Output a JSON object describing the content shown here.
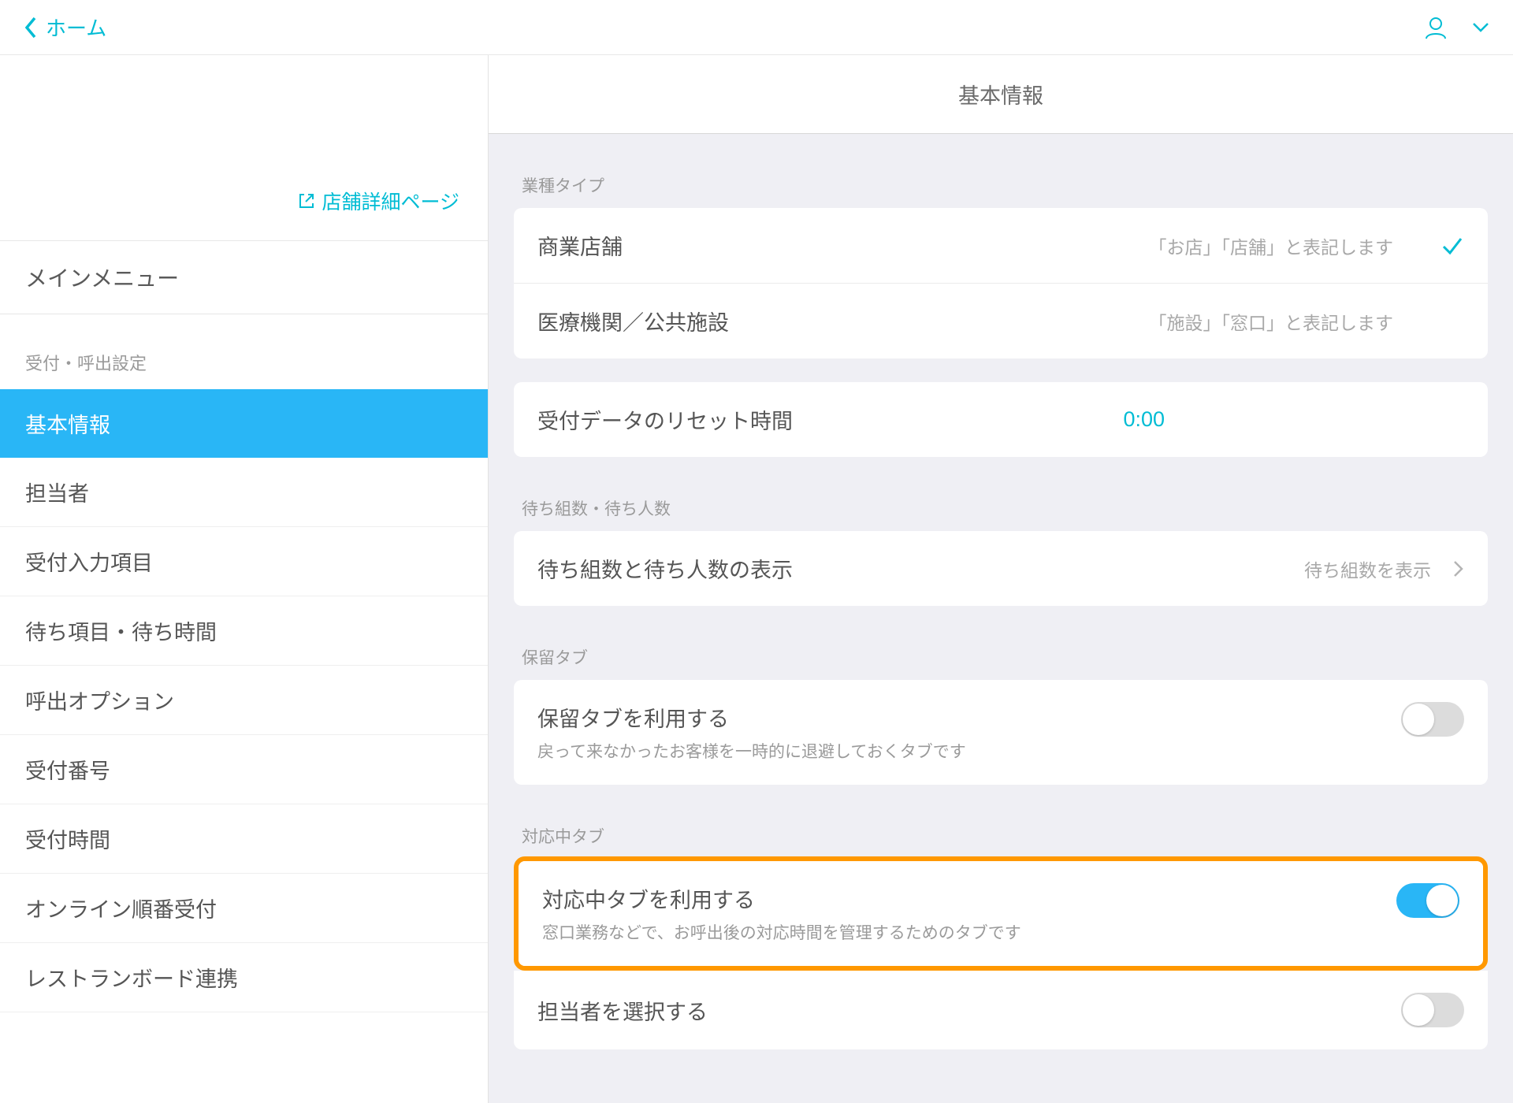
{
  "topbar": {
    "back_label": "ホーム"
  },
  "sidebar": {
    "store_link_label": "店舗詳細ページ",
    "main_menu_label": "メインメニュー",
    "section1_label": "受付・呼出設定",
    "items": [
      {
        "label": "基本情報"
      },
      {
        "label": "担当者"
      },
      {
        "label": "受付入力項目"
      },
      {
        "label": "待ち項目・待ち時間"
      },
      {
        "label": "呼出オプション"
      },
      {
        "label": "受付番号"
      },
      {
        "label": "受付時間"
      },
      {
        "label": "オンライン順番受付"
      },
      {
        "label": "レストランボード連携"
      }
    ]
  },
  "content": {
    "title": "基本情報",
    "business_type_label": "業種タイプ",
    "business_types": [
      {
        "name": "商業店舗",
        "desc": "「お店」「店舗」と表記します",
        "selected": true
      },
      {
        "name": "医療機関／公共施設",
        "desc": "「施設」「窓口」と表記します",
        "selected": false
      }
    ],
    "reset_label": "受付データのリセット時間",
    "reset_value": "0:00",
    "wait_group_label": "待ち組数・待ち人数",
    "wait_row_label": "待ち組数と待ち人数の表示",
    "wait_row_value": "待ち組数を表示",
    "hold_group_label": "保留タブ",
    "hold_row_title": "保留タブを利用する",
    "hold_row_sub": "戻って来なかったお客様を一時的に退避しておくタブです",
    "inprog_group_label": "対応中タブ",
    "inprog_row_title": "対応中タブを利用する",
    "inprog_row_sub": "窓口業務などで、お呼出後の対応時間を管理するためのタブです",
    "select_staff_label": "担当者を選択する"
  }
}
